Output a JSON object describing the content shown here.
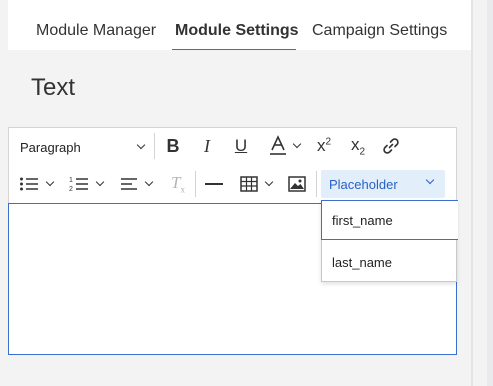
{
  "tabs": [
    {
      "label": "Module Manager"
    },
    {
      "label": "Module Settings"
    },
    {
      "label": "Campaign Settings"
    }
  ],
  "panel": {
    "title": "Text"
  },
  "toolbar": {
    "block_format": "Paragraph",
    "placeholder_label": "Placeholder",
    "superscript_label": "x",
    "superscript_exp": "2",
    "subscript_label": "x",
    "subscript_sub": "2"
  },
  "placeholder_menu": {
    "items": [
      "first_name",
      "last_name"
    ],
    "selected": "first_name"
  },
  "colors": {
    "accent_tab": "#2a8a5a",
    "focus_blue": "#3b6fce",
    "placeholder_bg": "#e3eefb",
    "placeholder_text": "#2762c5"
  }
}
